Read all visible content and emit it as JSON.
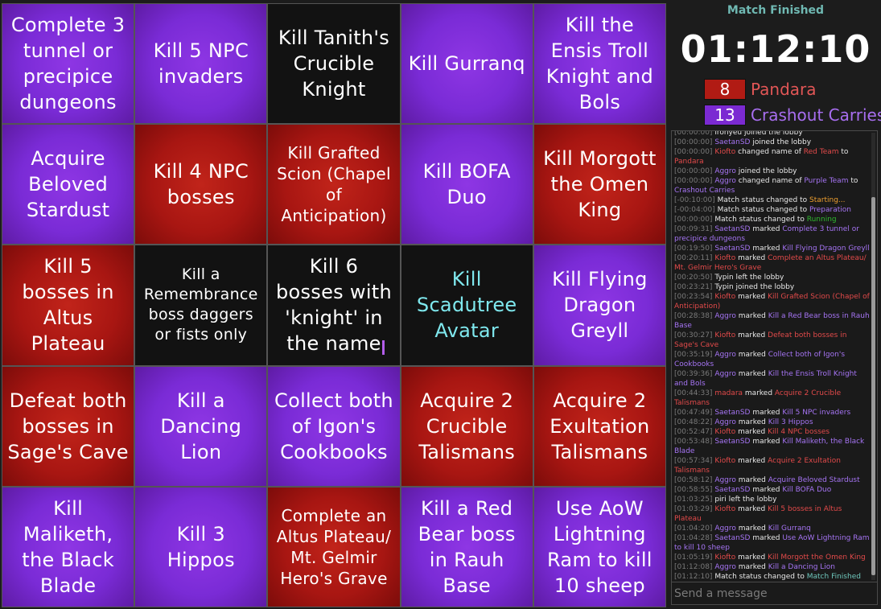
{
  "board": {
    "cells": [
      {
        "text": "Complete 3 tunnel or precipice dungeons",
        "color": "purple"
      },
      {
        "text": "Kill 5 NPC invaders",
        "color": "purple"
      },
      {
        "text": "Kill Tanith's Crucible Knight",
        "color": "black"
      },
      {
        "text": "Kill Gurranq",
        "color": "purple"
      },
      {
        "text": "Kill the Ensis Troll Knight and Bols",
        "color": "purple"
      },
      {
        "text": "Acquire Beloved Stardust",
        "color": "purple"
      },
      {
        "text": "Kill 4 NPC bosses",
        "color": "red"
      },
      {
        "text": "Kill Grafted Scion (Chapel of Anticipation)",
        "color": "red"
      },
      {
        "text": "Kill BOFA Duo",
        "color": "purple"
      },
      {
        "text": "Kill Morgott the Omen King",
        "color": "red"
      },
      {
        "text": "Kill 5 bosses in Altus Plateau",
        "color": "red"
      },
      {
        "text": "Kill a Remembrance boss daggers or fists only",
        "color": "black"
      },
      {
        "text": "Kill 6 bosses with 'knight' in the name",
        "color": "black"
      },
      {
        "text": "Kill Scadutree Avatar",
        "color": "black"
      },
      {
        "text": "Kill Flying Dragon Greyll",
        "color": "purple"
      },
      {
        "text": "Defeat both bosses in Sage's Cave",
        "color": "red"
      },
      {
        "text": "Kill a Dancing Lion",
        "color": "purple"
      },
      {
        "text": "Collect both of Igon's Cookbooks",
        "color": "purple"
      },
      {
        "text": "Acquire 2 Crucible Talismans",
        "color": "red"
      },
      {
        "text": "Acquire 2 Exultation Talismans",
        "color": "red"
      },
      {
        "text": "Kill Maliketh, the Black Blade",
        "color": "purple"
      },
      {
        "text": "Kill 3 Hippos",
        "color": "purple"
      },
      {
        "text": "Complete an Altus Plateau/ Mt. Gelmir Hero's Grave",
        "color": "red"
      },
      {
        "text": "Kill a Red Bear boss in Rauh Base",
        "color": "purple"
      },
      {
        "text": "Use AoW Lightning Ram to kill 10 sheep",
        "color": "purple"
      }
    ]
  },
  "side": {
    "status": "Match Finished",
    "timer": "01:12:10",
    "teams": [
      {
        "score": "8",
        "name": "Pandara",
        "color": "#b11b14"
      },
      {
        "score": "13",
        "name": "Crashout Carries",
        "color": "#7b2ad2"
      }
    ]
  },
  "chat": {
    "input_placeholder": "Send a message",
    "messages": [
      [
        {
          "t": "[00:00:00]",
          "c": "ts"
        },
        {
          "t": " ironyeu joined the lobby",
          "c": "u-white"
        }
      ],
      [
        {
          "t": "[00:00:00]",
          "c": "ts"
        },
        {
          "t": " SaetanSD",
          "c": "u-purple"
        },
        {
          "t": " joined the lobby",
          "c": "u-white"
        }
      ],
      [
        {
          "t": "[00:00:00]",
          "c": "ts"
        },
        {
          "t": " Kiofto",
          "c": "u-red"
        },
        {
          "t": " changed name of ",
          "c": "u-white"
        },
        {
          "t": "Red Team",
          "c": "t-red"
        },
        {
          "t": " to ",
          "c": "u-white"
        },
        {
          "t": "Pandara",
          "c": "t-red"
        }
      ],
      [
        {
          "t": "[00:00:00]",
          "c": "ts"
        },
        {
          "t": " Aggro",
          "c": "u-purple"
        },
        {
          "t": " joined the lobby",
          "c": "u-white"
        }
      ],
      [
        {
          "t": "[00:00:00]",
          "c": "ts"
        },
        {
          "t": " Aggro",
          "c": "u-purple"
        },
        {
          "t": " changed name of ",
          "c": "u-white"
        },
        {
          "t": "Purple Team",
          "c": "t-purple"
        },
        {
          "t": " to ",
          "c": "u-white"
        },
        {
          "t": "Crashout Carries",
          "c": "t-purple"
        }
      ],
      [
        {
          "t": "[-00:10:00]",
          "c": "ts"
        },
        {
          "t": " Match status changed to ",
          "c": "u-white"
        },
        {
          "t": "Starting...",
          "c": "t-orange"
        }
      ],
      [
        {
          "t": "[-00:04:00]",
          "c": "ts"
        },
        {
          "t": " Match status changed to ",
          "c": "u-white"
        },
        {
          "t": "Preparation",
          "c": "t-violet"
        }
      ],
      [
        {
          "t": "[00:00:00]",
          "c": "ts"
        },
        {
          "t": " Match status changed to ",
          "c": "u-white"
        },
        {
          "t": "Running",
          "c": "t-green"
        }
      ],
      [
        {
          "t": "[00:09:31]",
          "c": "ts"
        },
        {
          "t": " SaetanSD",
          "c": "u-purple"
        },
        {
          "t": " marked ",
          "c": "u-white"
        },
        {
          "t": "Complete 3 tunnel or precipice dungeons",
          "c": "t-purple"
        }
      ],
      [
        {
          "t": "[00:19:50]",
          "c": "ts"
        },
        {
          "t": " SaetanSD",
          "c": "u-purple"
        },
        {
          "t": " marked ",
          "c": "u-white"
        },
        {
          "t": "Kill Flying Dragon Greyll",
          "c": "t-purple"
        }
      ],
      [
        {
          "t": "[00:20:11]",
          "c": "ts"
        },
        {
          "t": " Kiofto",
          "c": "u-red"
        },
        {
          "t": " marked ",
          "c": "u-white"
        },
        {
          "t": "Complete an Altus Plateau/ Mt. Gelmir Hero's Grave",
          "c": "t-red"
        }
      ],
      [
        {
          "t": "[00:20:50]",
          "c": "ts"
        },
        {
          "t": " Typin left the lobby",
          "c": "u-white"
        }
      ],
      [
        {
          "t": "[00:23:21]",
          "c": "ts"
        },
        {
          "t": " Typin joined the lobby",
          "c": "u-white"
        }
      ],
      [
        {
          "t": "[00:23:54]",
          "c": "ts"
        },
        {
          "t": " Kiofto",
          "c": "u-red"
        },
        {
          "t": " marked ",
          "c": "u-white"
        },
        {
          "t": "Kill Grafted Scion (Chapel of Anticipation)",
          "c": "t-red"
        }
      ],
      [
        {
          "t": "[00:28:38]",
          "c": "ts"
        },
        {
          "t": " Aggro",
          "c": "u-purple"
        },
        {
          "t": " marked ",
          "c": "u-white"
        },
        {
          "t": "Kill a Red Bear boss in Rauh Base",
          "c": "t-purple"
        }
      ],
      [
        {
          "t": "[00:30:27]",
          "c": "ts"
        },
        {
          "t": " Kiofto",
          "c": "u-red"
        },
        {
          "t": " marked ",
          "c": "u-white"
        },
        {
          "t": "Defeat both bosses in Sage's Cave",
          "c": "t-red"
        }
      ],
      [
        {
          "t": "[00:35:19]",
          "c": "ts"
        },
        {
          "t": " Aggro",
          "c": "u-purple"
        },
        {
          "t": " marked ",
          "c": "u-white"
        },
        {
          "t": "Collect both of Igon's Cookbooks",
          "c": "t-purple"
        }
      ],
      [
        {
          "t": "[00:39:36]",
          "c": "ts"
        },
        {
          "t": " Aggro",
          "c": "u-purple"
        },
        {
          "t": " marked ",
          "c": "u-white"
        },
        {
          "t": "Kill the Ensis Troll Knight and Bols",
          "c": "t-purple"
        }
      ],
      [
        {
          "t": "[00:44:33]",
          "c": "ts"
        },
        {
          "t": " madara",
          "c": "u-red"
        },
        {
          "t": " marked ",
          "c": "u-white"
        },
        {
          "t": "Acquire 2 Crucible Talismans",
          "c": "t-red"
        }
      ],
      [
        {
          "t": "[00:47:49]",
          "c": "ts"
        },
        {
          "t": " SaetanSD",
          "c": "u-purple"
        },
        {
          "t": " marked ",
          "c": "u-white"
        },
        {
          "t": "Kill 5 NPC invaders",
          "c": "t-purple"
        }
      ],
      [
        {
          "t": "[00:48:22]",
          "c": "ts"
        },
        {
          "t": " Aggro",
          "c": "u-purple"
        },
        {
          "t": " marked ",
          "c": "u-white"
        },
        {
          "t": "Kill 3 Hippos",
          "c": "t-purple"
        }
      ],
      [
        {
          "t": "[00:52:47]",
          "c": "ts"
        },
        {
          "t": " Kiofto",
          "c": "u-red"
        },
        {
          "t": " marked ",
          "c": "u-white"
        },
        {
          "t": "Kill 4 NPC bosses",
          "c": "t-red"
        }
      ],
      [
        {
          "t": "[00:53:48]",
          "c": "ts"
        },
        {
          "t": " SaetanSD",
          "c": "u-purple"
        },
        {
          "t": " marked ",
          "c": "u-white"
        },
        {
          "t": "Kill Maliketh, the Black Blade",
          "c": "t-purple"
        }
      ],
      [
        {
          "t": "[00:57:34]",
          "c": "ts"
        },
        {
          "t": " Kiofto",
          "c": "u-red"
        },
        {
          "t": " marked ",
          "c": "u-white"
        },
        {
          "t": "Acquire 2 Exultation Talismans",
          "c": "t-red"
        }
      ],
      [
        {
          "t": "[00:58:12]",
          "c": "ts"
        },
        {
          "t": " Aggro",
          "c": "u-purple"
        },
        {
          "t": " marked ",
          "c": "u-white"
        },
        {
          "t": "Acquire Beloved Stardust",
          "c": "t-purple"
        }
      ],
      [
        {
          "t": "[00:58:55]",
          "c": "ts"
        },
        {
          "t": " SaetanSD",
          "c": "u-purple"
        },
        {
          "t": " marked ",
          "c": "u-white"
        },
        {
          "t": "Kill BOFA Duo",
          "c": "t-purple"
        }
      ],
      [
        {
          "t": "[01:03:25]",
          "c": "ts"
        },
        {
          "t": " piri left the lobby",
          "c": "u-white"
        }
      ],
      [
        {
          "t": "[01:03:29]",
          "c": "ts"
        },
        {
          "t": " Kiofto",
          "c": "u-red"
        },
        {
          "t": " marked ",
          "c": "u-white"
        },
        {
          "t": "Kill 5 bosses in Altus Plateau",
          "c": "t-red"
        }
      ],
      [
        {
          "t": "[01:04:20]",
          "c": "ts"
        },
        {
          "t": " Aggro",
          "c": "u-purple"
        },
        {
          "t": " marked ",
          "c": "u-white"
        },
        {
          "t": "Kill Gurranq",
          "c": "t-purple"
        }
      ],
      [
        {
          "t": "[01:04:28]",
          "c": "ts"
        },
        {
          "t": " SaetanSD",
          "c": "u-purple"
        },
        {
          "t": " marked ",
          "c": "u-white"
        },
        {
          "t": "Use AoW Lightning Ram to kill 10 sheep",
          "c": "t-purple"
        }
      ],
      [
        {
          "t": "[01:05:19]",
          "c": "ts"
        },
        {
          "t": " Kiofto",
          "c": "u-red"
        },
        {
          "t": " marked ",
          "c": "u-white"
        },
        {
          "t": "Kill Morgott the Omen King",
          "c": "t-red"
        }
      ],
      [
        {
          "t": "[01:12:08]",
          "c": "ts"
        },
        {
          "t": " Aggro",
          "c": "u-purple"
        },
        {
          "t": " marked ",
          "c": "u-white"
        },
        {
          "t": "Kill a Dancing Lion",
          "c": "t-purple"
        }
      ],
      [
        {
          "t": "[01:12:10]",
          "c": "ts"
        },
        {
          "t": " Match status changed to ",
          "c": "u-white"
        },
        {
          "t": "Match Finished",
          "c": "t-teal"
        }
      ]
    ]
  }
}
